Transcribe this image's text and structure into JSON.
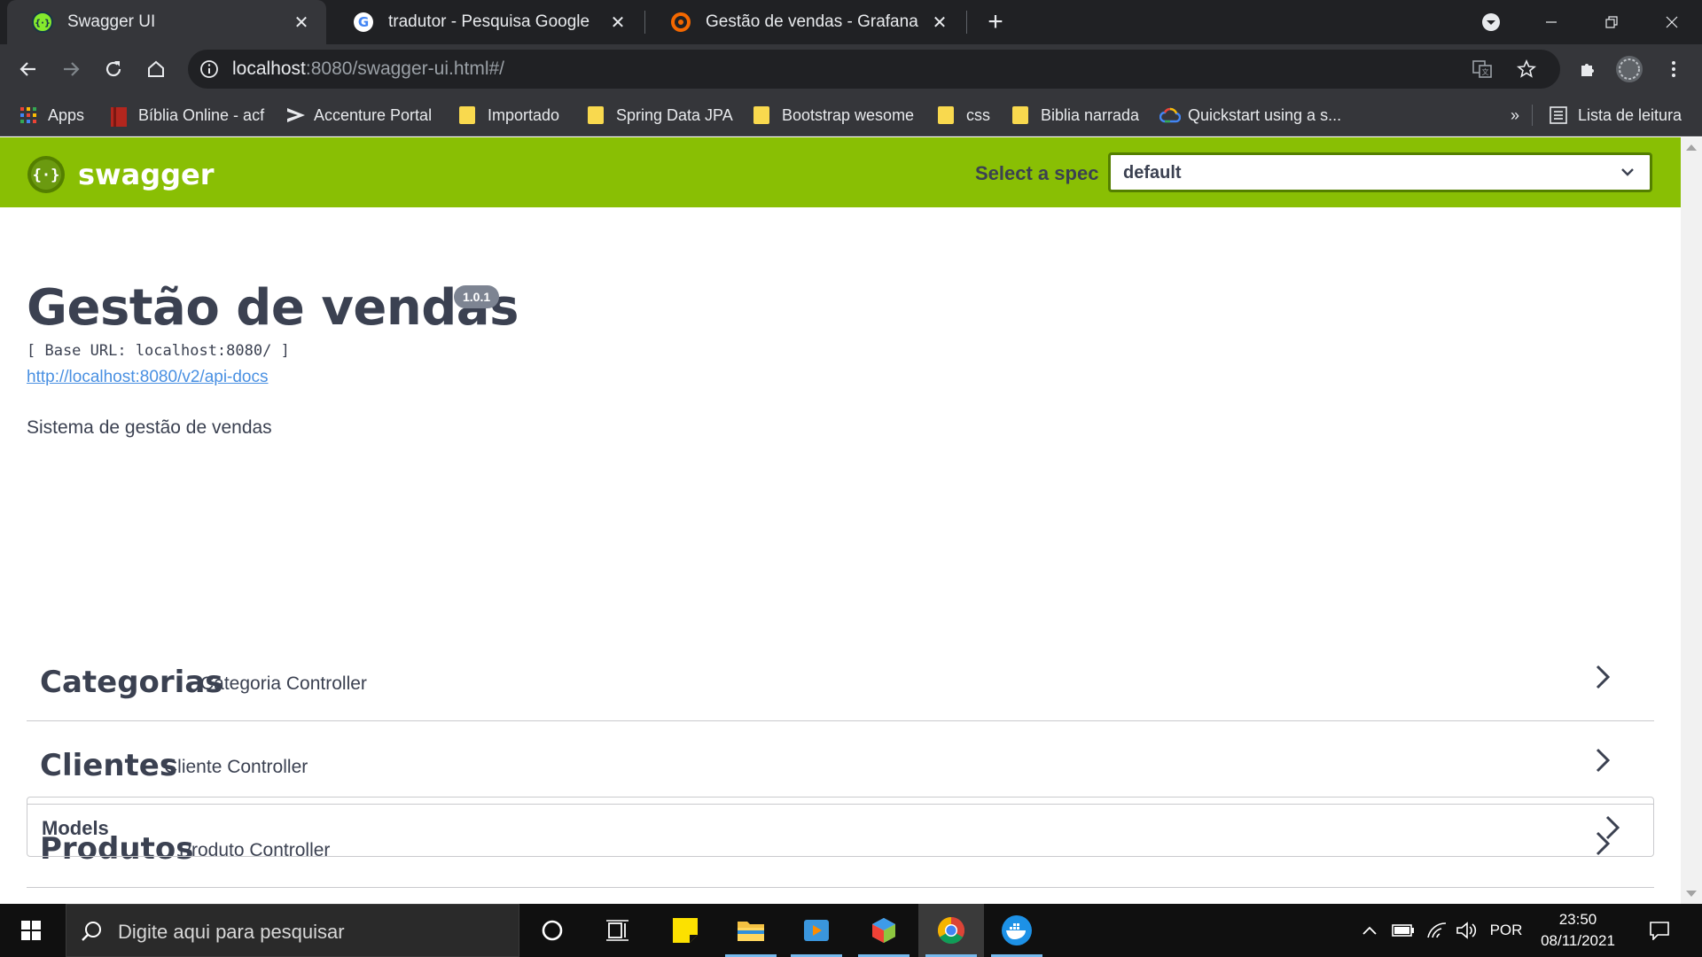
{
  "browser": {
    "tabs": [
      {
        "title": "Swagger UI",
        "active": true
      },
      {
        "title": "tradutor - Pesquisa Google",
        "active": false
      },
      {
        "title": "Gestão de vendas - Grafana",
        "active": false
      }
    ],
    "url_host": "localhost",
    "url_path": ":8080/swagger-ui.html#/",
    "bookmarks": [
      "Apps",
      "Bíblia Online - acf",
      "Accenture Portal",
      "Importado",
      "Spring Data JPA",
      "Bootstrap wesome",
      "css",
      "Biblia narrada",
      "Quickstart using a s...",
      "»",
      "Lista de leitura"
    ]
  },
  "swagger": {
    "logo_text": "swagger",
    "spec_label": "Select a spec",
    "spec_value": "default",
    "title": "Gestão de vendas",
    "version": "1.0.1",
    "base_url": "[ Base URL: localhost:8080/ ]",
    "api_docs_link": "http://localhost:8080/v2/api-docs",
    "description": "Sistema de gestão de vendas",
    "tags": [
      {
        "name": "Categorias",
        "description": "Categoria Controller"
      },
      {
        "name": "Clientes",
        "description": "Cliente Controller"
      },
      {
        "name": "Produtos",
        "description": "Produto Controller"
      }
    ],
    "models_label": "Models",
    "accent_color": "#89bf04"
  },
  "taskbar": {
    "search_placeholder": "Digite aqui para pesquisar",
    "language": "POR",
    "time": "23:50",
    "date": "08/11/2021"
  }
}
